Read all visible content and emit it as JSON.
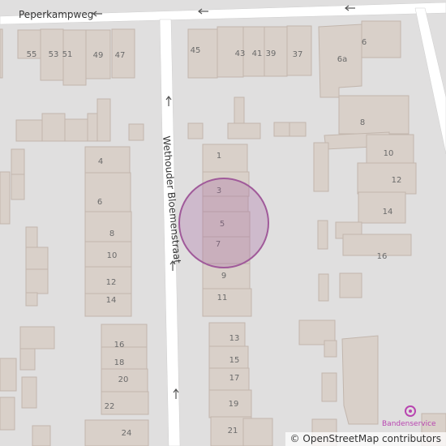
{
  "map": {
    "streets": {
      "peperkampweg": "Peperkampweg",
      "wethouder_bloemenstraat": "Wethouder Bloemenstraat"
    },
    "house_numbers": {
      "n55": "55",
      "n53": "53",
      "n51": "51",
      "n49": "49",
      "n47": "47",
      "n45": "45",
      "n43": "43",
      "n41": "41",
      "n39": "39",
      "n37": "37",
      "n6": "6",
      "n6a": "6a",
      "n8": "8",
      "n10": "10",
      "n12": "12",
      "n14": "14",
      "n16": "16",
      "n1": "1",
      "n3": "3",
      "n5": "5",
      "n7": "7",
      "n9": "9",
      "n11": "11",
      "n13": "13",
      "n15": "15",
      "n17": "17",
      "n19": "19",
      "n21": "21",
      "w4": "4",
      "w6": "6",
      "w8": "8",
      "w10": "10",
      "w12": "12",
      "w14": "14",
      "w16": "16",
      "w18": "18",
      "w20": "20",
      "w22": "22",
      "w24": "24"
    },
    "poi": {
      "name": "Bandenservice",
      "icon": "tyre-shop-icon",
      "color": "#b845b0"
    },
    "highlight": {
      "house_number": "5",
      "color": "#a05a9a"
    },
    "colors": {
      "road": "#ffffff",
      "building": "#d9d0c9",
      "land": "#e0dfdf"
    }
  },
  "attribution": {
    "symbol": "©",
    "text": "OpenStreetMap contributors"
  }
}
